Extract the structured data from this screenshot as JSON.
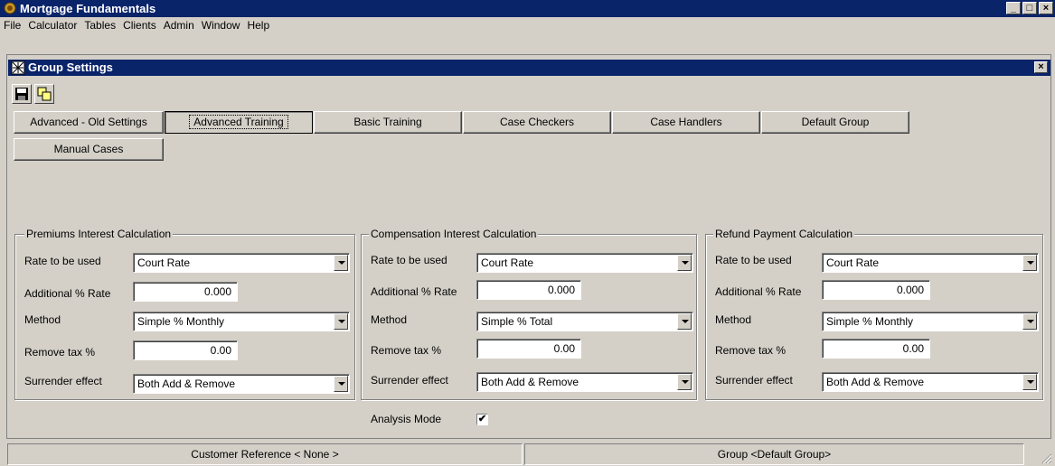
{
  "app": {
    "title": "Mortgage Fundamentals"
  },
  "menu": [
    "File",
    "Calculator",
    "Tables",
    "Clients",
    "Admin",
    "Window",
    "Help"
  ],
  "child": {
    "title": "Group Settings"
  },
  "groups": [
    "Advanced - Old Settings",
    "Advanced Training",
    "Basic Training",
    "Case Checkers",
    "Case Handlers",
    "Default Group",
    "Manual Cases"
  ],
  "labels": {
    "rate": "Rate to be used",
    "additional": "Additional % Rate",
    "method": "Method",
    "remove_tax": "Remove tax %",
    "surrender": "Surrender effect"
  },
  "panels": [
    {
      "title": "Premiums Interest Calculation",
      "rate": "Court Rate",
      "additional": "0.000",
      "method": "Simple % Monthly",
      "remove_tax": "0.00",
      "surrender": "Both Add & Remove"
    },
    {
      "title": "Compensation Interest Calculation",
      "rate": "Court Rate",
      "additional": "0.000",
      "method": "Simple % Total",
      "remove_tax": "0.00",
      "surrender": "Both Add & Remove"
    },
    {
      "title": "Refund Payment Calculation",
      "rate": "Court Rate",
      "additional": "0.000",
      "method": "Simple % Monthly",
      "remove_tax": "0.00",
      "surrender": "Both Add & Remove"
    }
  ],
  "analysis": {
    "label": "Analysis Mode",
    "checked": true,
    "mark": "✔"
  },
  "status": {
    "customer": "Customer Reference < None >",
    "group": "Group <Default Group>"
  },
  "icons": {
    "minimize": "_",
    "maximize": "□",
    "close": "×"
  }
}
